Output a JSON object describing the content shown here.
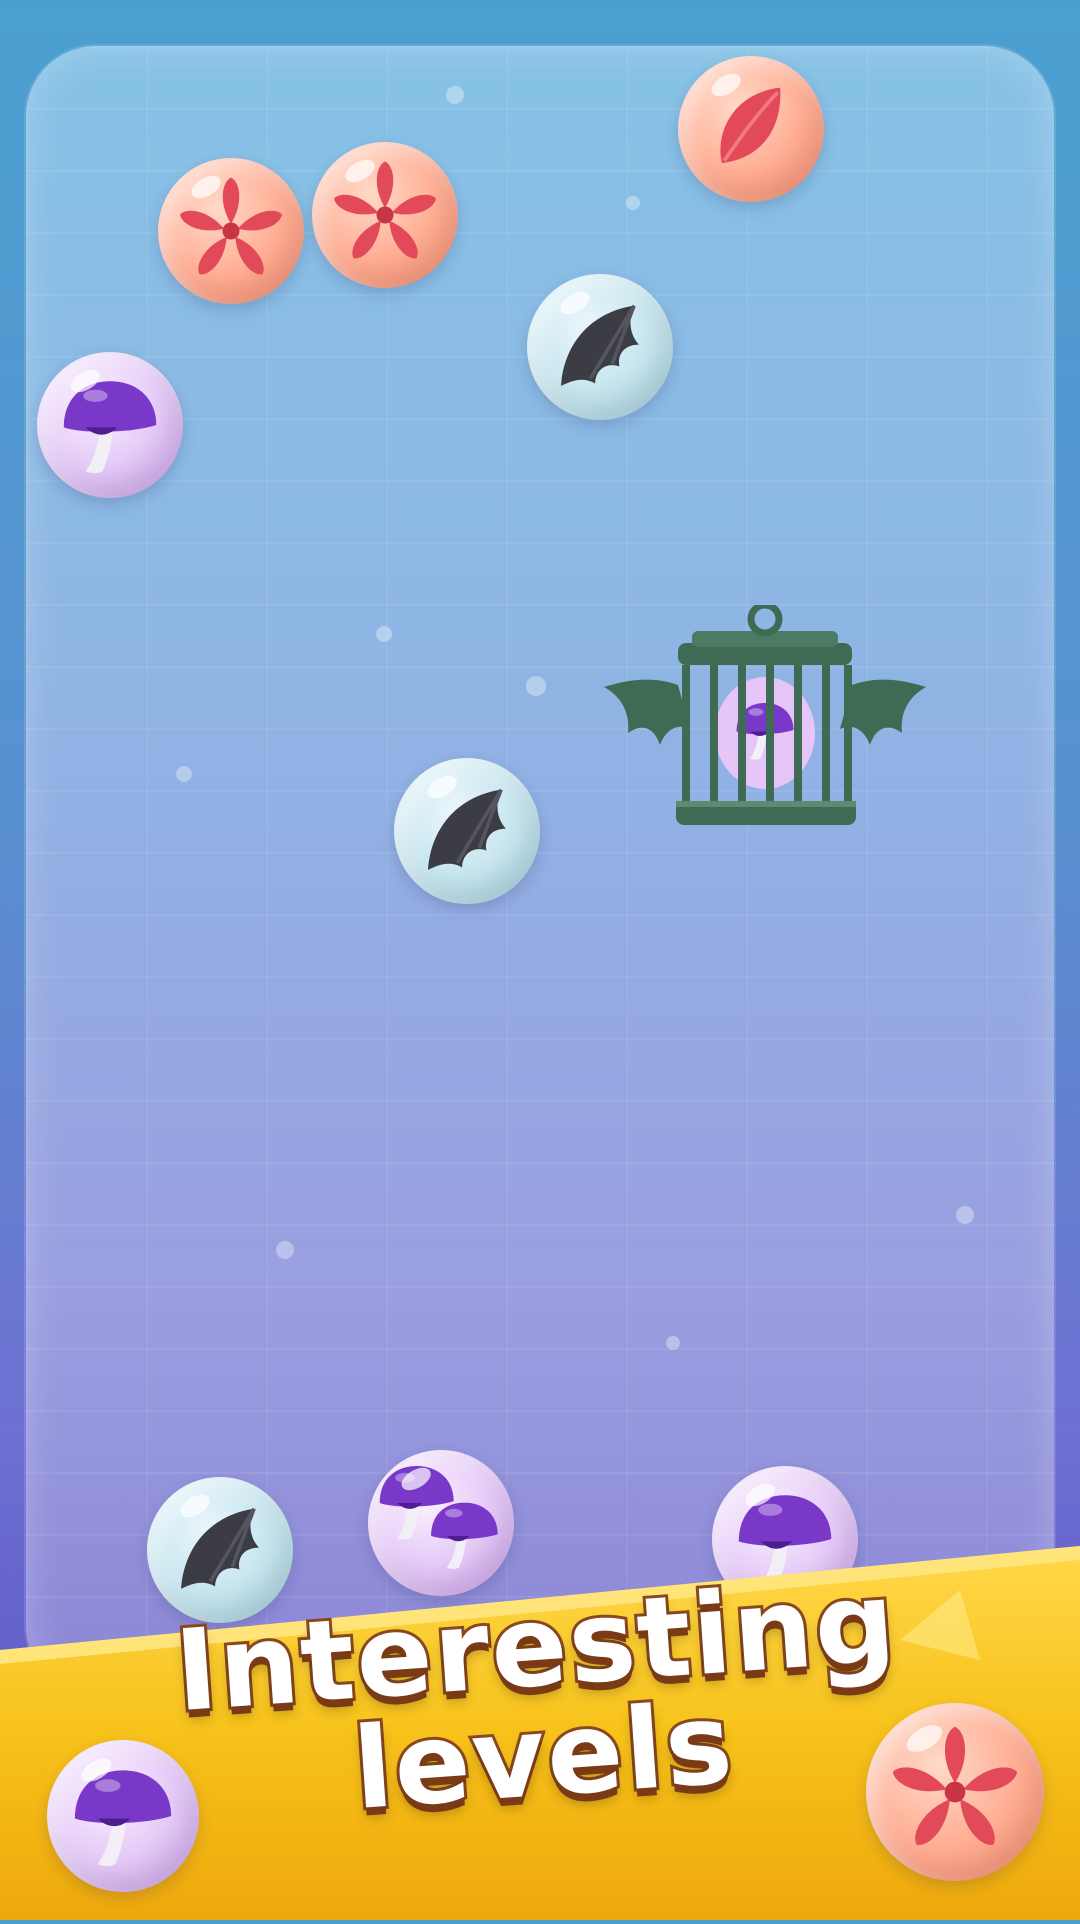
{
  "banner": {
    "line1": "Interesting",
    "line2": "levels"
  },
  "colors": {
    "banner_yellow": "#f7c21a",
    "banner_light": "#ffd84a",
    "text_outline": "#8a4a20",
    "wing": "#3c3c44",
    "cage": "#3f6b55",
    "mushroom": "#7a38c8",
    "flower": "#e24a5a"
  },
  "pieces": [
    {
      "type": "flower-bubble",
      "icon": "flower-icon"
    },
    {
      "type": "flower-bubble",
      "icon": "flower-icon"
    },
    {
      "type": "petal-bubble",
      "icon": "petal-icon"
    },
    {
      "type": "wing-bubble",
      "icon": "bat-wing-icon"
    },
    {
      "type": "mushroom-bubble",
      "icon": "mushroom-icon"
    },
    {
      "type": "caged-mushroom",
      "icon": "winged-cage-icon"
    },
    {
      "type": "wing-bubble",
      "icon": "bat-wing-icon"
    },
    {
      "type": "wing-bubble",
      "icon": "bat-wing-icon"
    },
    {
      "type": "double-mushroom-bubble",
      "icon": "mushrooms-icon"
    },
    {
      "type": "mushroom-bubble",
      "icon": "mushroom-icon"
    },
    {
      "type": "mushroom-bubble",
      "icon": "mushroom-icon"
    },
    {
      "type": "flower-bubble",
      "icon": "flower-icon"
    }
  ]
}
